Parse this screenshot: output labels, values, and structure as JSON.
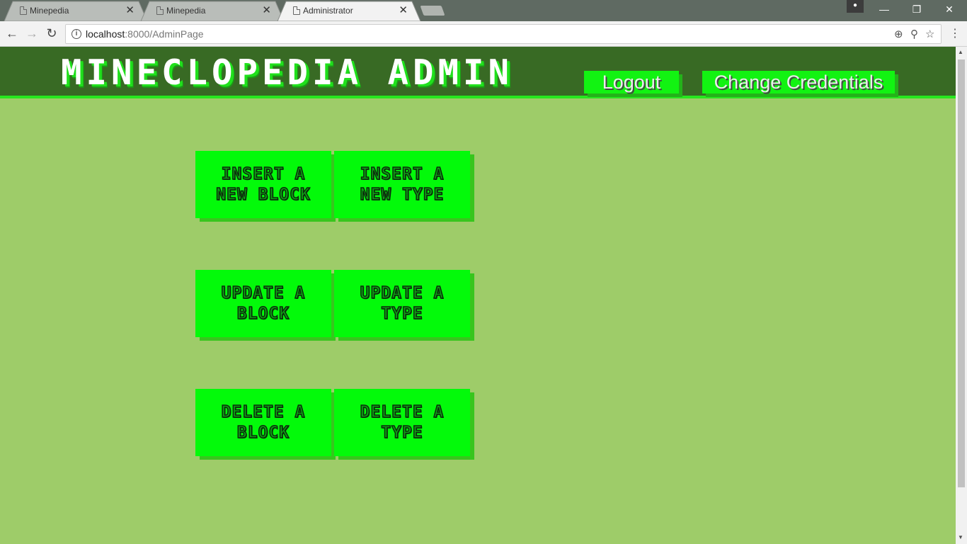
{
  "browser": {
    "tabs": [
      {
        "title": "Minepedia"
      },
      {
        "title": "Minepedia"
      },
      {
        "title": "Administrator"
      }
    ],
    "close_glyph": "✕",
    "url_host": "localhost",
    "url_path": ":8000/AdminPage",
    "window_controls": {
      "minimize": "—",
      "restore": "❐",
      "close": "✕"
    },
    "nav": {
      "back": "←",
      "forward": "→",
      "reload": "↻"
    },
    "icons": {
      "zoom": "⊕",
      "extension": "⚲",
      "bookmark": "☆",
      "menu": "⋮",
      "info": "i",
      "profile": "●"
    }
  },
  "page": {
    "logo_text": "MINECLOPEDIA ADMIN",
    "header_buttons": {
      "logout": "Logout",
      "change_credentials": "Change Credentials"
    },
    "actions": [
      {
        "line1": "INSERT A",
        "line2": "NEW BLOCK"
      },
      {
        "line1": "INSERT A",
        "line2": "NEW TYPE"
      },
      {
        "line1": "UPDATE A",
        "line2": "BLOCK"
      },
      {
        "line1": "UPDATE A",
        "line2": "TYPE"
      },
      {
        "line1": "DELETE A",
        "line2": "BLOCK"
      },
      {
        "line1": "DELETE A",
        "line2": "TYPE"
      }
    ]
  },
  "colors": {
    "page_bg": "#9ecc69",
    "header_bg": "#386a24",
    "button_green": "#03fa0a",
    "button_shadow": "#38c51e"
  }
}
